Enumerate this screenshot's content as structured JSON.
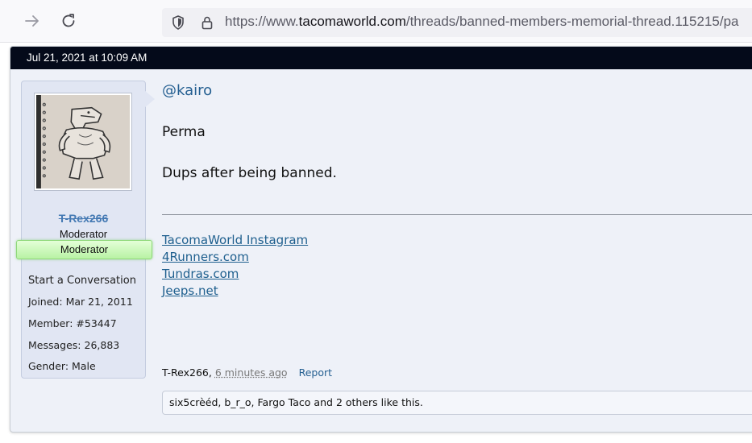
{
  "browser": {
    "url_prefix": "https://www.",
    "url_domain": "tacomaworld.com",
    "url_path": "/threads/banned-members-memorial-thread.115215/pa"
  },
  "post": {
    "date": "Jul 21, 2021 at 10:09 AM",
    "author": {
      "username": "T-Rex266",
      "title": "Moderator",
      "badge": "Moderator",
      "start_conversation": "Start a Conversation",
      "stats": [
        {
          "label": "Joined:",
          "value": "Mar 21, 2011"
        },
        {
          "label": "Member:",
          "value": "#53447"
        },
        {
          "label": "Messages:",
          "value": "26,883"
        },
        {
          "label": "Gender:",
          "value": "Male"
        }
      ]
    },
    "body": {
      "mention": "@kairo",
      "line1": "Perma",
      "line2": "Dups after being banned."
    },
    "signature_links": [
      "TacomaWorld Instagram",
      "4Runners.com",
      "Tundras.com",
      "Jeeps.net"
    ],
    "meta": {
      "author": "T-Rex266,",
      "time": "6 minutes ago",
      "report": "Report"
    },
    "likes": {
      "names": "six5crèéd, b_r_o, Fargo Taco",
      "connector": "and",
      "others": "2 others",
      "suffix": "like this."
    }
  }
}
